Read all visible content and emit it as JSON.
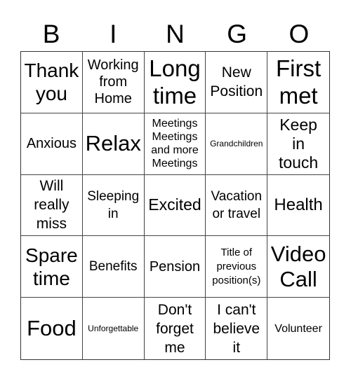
{
  "card": {
    "header": [
      "B",
      "I",
      "N",
      "G",
      "O"
    ],
    "cells": [
      "Thank you",
      "Working from Home",
      "Long time",
      "New Position",
      "First met",
      "Anxious",
      "Relax",
      "Meetings Meetings and more Meetings",
      "Grandchildren",
      "Keep in touch",
      "Will really miss",
      "Sleeping in",
      "Excited",
      "Vacation or travel",
      "Health",
      "Spare time",
      "Benefits",
      "Pension",
      "Title of previous position(s)",
      "Video Call",
      "Food",
      "Unforgettable",
      "Don't forget me",
      "I can't believe it",
      "Volunteer"
    ],
    "cell_lines": [
      [
        "Thank",
        "you"
      ],
      [
        "Working",
        "from",
        "Home"
      ],
      [
        "Long",
        "time"
      ],
      [
        "New",
        "Position"
      ],
      [
        "First",
        "met"
      ],
      [
        "Anxious"
      ],
      [
        "Relax"
      ],
      [
        "Meetings",
        "Meetings",
        "and more",
        "Meetings"
      ],
      [
        "Grandchildren"
      ],
      [
        "Keep",
        "in",
        "touch"
      ],
      [
        "Will",
        "really",
        "miss"
      ],
      [
        "Sleeping",
        "in"
      ],
      [
        "Excited"
      ],
      [
        "Vacation",
        "or travel"
      ],
      [
        "Health"
      ],
      [
        "Spare",
        "time"
      ],
      [
        "Benefits"
      ],
      [
        "Pension"
      ],
      [
        "Title of",
        "previous",
        "position(s)"
      ],
      [
        "Video",
        "Call"
      ],
      [
        "Food"
      ],
      [
        "Unforgettable"
      ],
      [
        "Don't",
        "forget",
        "me"
      ],
      [
        "I can't",
        "believe",
        "it"
      ],
      [
        "Volunteer"
      ]
    ]
  }
}
